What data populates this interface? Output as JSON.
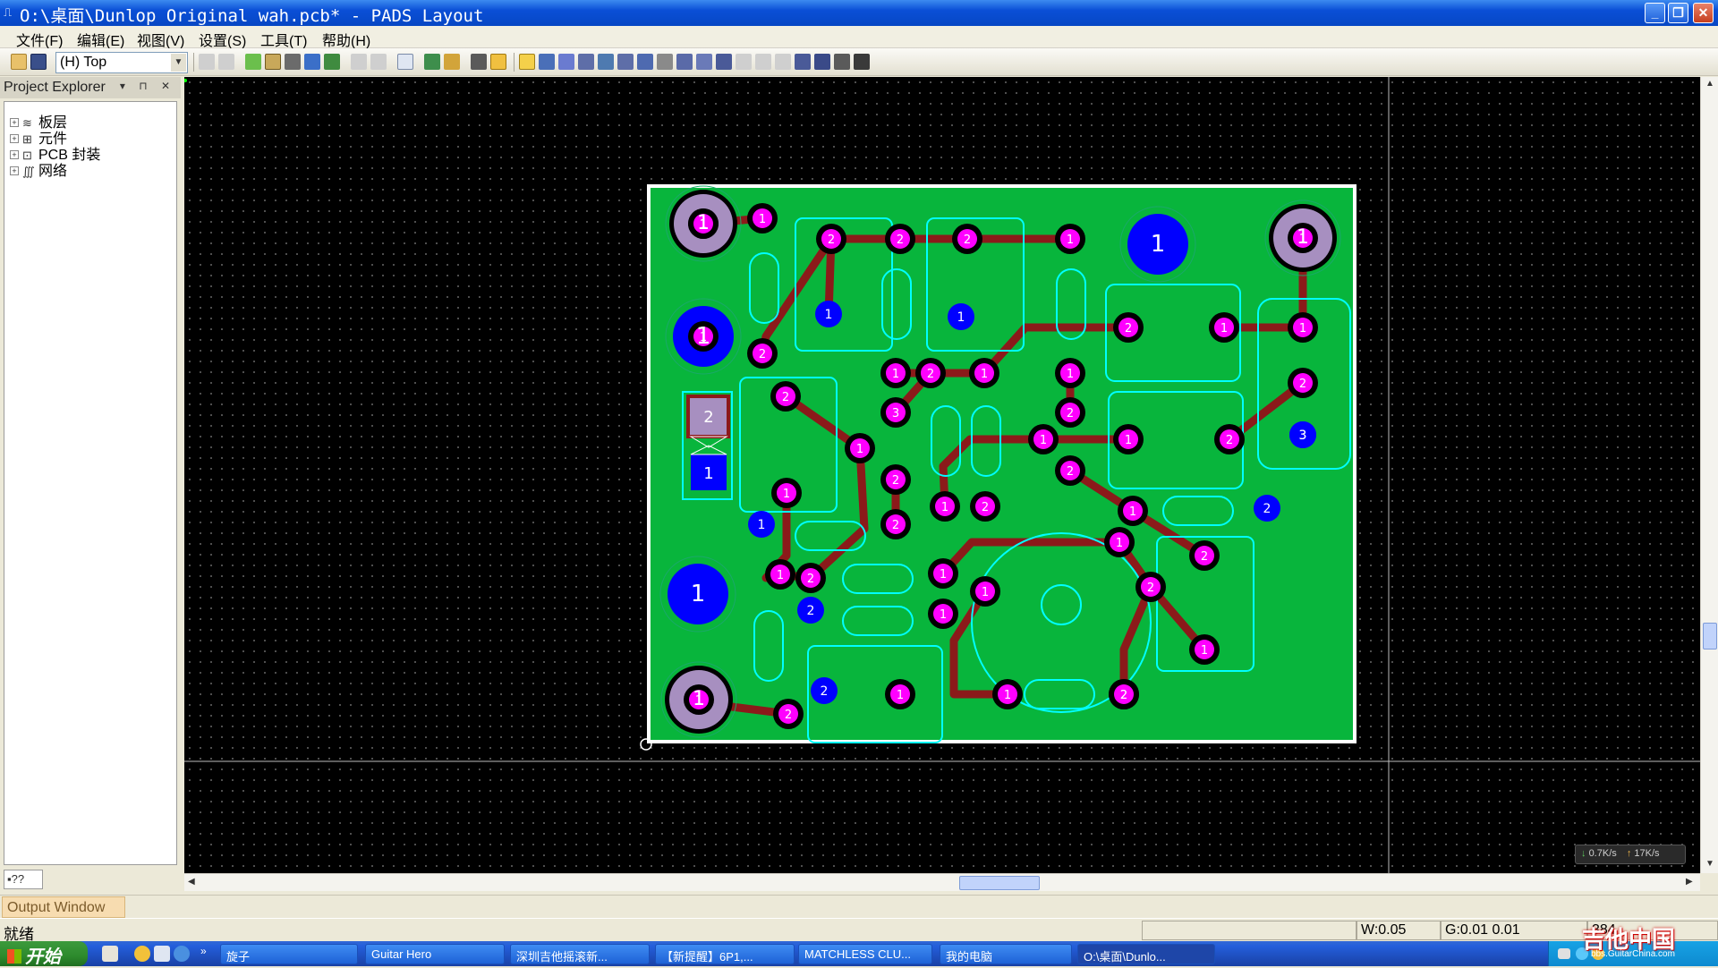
{
  "window": {
    "title": "O:\\桌面\\Dunlop Original wah.pcb* - PADS Layout",
    "minimize_label": "_",
    "maximize_label": "❐",
    "close_label": "✕"
  },
  "menubar": {
    "items": [
      "文件(F)",
      "编辑(E)",
      "视图(V)",
      "设置(S)",
      "工具(T)",
      "帮助(H)"
    ]
  },
  "toolbar": {
    "layer_select": "(H) Top"
  },
  "explorer": {
    "title": "Project Explorer",
    "items": [
      "板层",
      "元件",
      "PCB 封装",
      "网络"
    ],
    "tab_label": "??"
  },
  "output": {
    "tab_label": "Output Window"
  },
  "statusbar": {
    "status": "就绪",
    "width_value": "W:0.05",
    "grid_value": "G:0.01 0.01",
    "coord_value": "384"
  },
  "netspeed": {
    "down": "0.7K/s",
    "up": "17K/s"
  },
  "taskbar": {
    "start_label": "开始",
    "buttons": [
      "旋子",
      "Guitar Hero",
      "深圳吉他摇滚新...",
      "【新提醒】6P1,...",
      "MATCHLESS CLU...",
      "我的电脑",
      "O:\\桌面\\Dunlo..."
    ]
  },
  "watermark": {
    "text": "吉他中国",
    "sub": "bbs.GuitarChina.com"
  },
  "colors": {
    "board_fill": "#08b53c",
    "pad_color": "#ff00ff",
    "via_color": "#0000ff",
    "trace_color": "#8b1a1a",
    "outline_color": "#00ffff",
    "canvas_bg": "#000000"
  },
  "board": {
    "pads": [
      {
        "label": "1"
      },
      {
        "label": "1"
      },
      {
        "label": "2"
      },
      {
        "label": "2"
      },
      {
        "label": "2"
      },
      {
        "label": "1"
      },
      {
        "label": "1"
      },
      {
        "label": "1"
      },
      {
        "label": "1"
      },
      {
        "label": "1"
      },
      {
        "label": "2"
      },
      {
        "label": "1"
      },
      {
        "label": "2"
      },
      {
        "label": "1"
      },
      {
        "label": "2"
      },
      {
        "label": "2"
      },
      {
        "label": "1"
      },
      {
        "label": "2"
      },
      {
        "label": "1"
      },
      {
        "label": "1"
      },
      {
        "label": "2"
      },
      {
        "label": "1"
      },
      {
        "label": "3"
      },
      {
        "label": "2"
      },
      {
        "label": "3"
      },
      {
        "label": "1"
      },
      {
        "label": "1"
      },
      {
        "label": "1"
      },
      {
        "label": "2"
      },
      {
        "label": "2"
      },
      {
        "label": "2"
      },
      {
        "label": "1"
      },
      {
        "label": "2"
      },
      {
        "label": "2"
      },
      {
        "label": "1"
      },
      {
        "label": "1"
      },
      {
        "label": "3"
      },
      {
        "label": "2"
      },
      {
        "label": "1"
      },
      {
        "label": "2"
      },
      {
        "label": "2"
      },
      {
        "label": "2"
      },
      {
        "label": "1"
      },
      {
        "label": "1"
      },
      {
        "label": "1"
      },
      {
        "label": "1"
      },
      {
        "label": "1"
      },
      {
        "label": "2"
      },
      {
        "label": "2"
      },
      {
        "label": "1"
      },
      {
        "label": "1"
      },
      {
        "label": "2"
      },
      {
        "label": "1"
      },
      {
        "label": "2"
      },
      {
        "label": "1"
      }
    ]
  }
}
